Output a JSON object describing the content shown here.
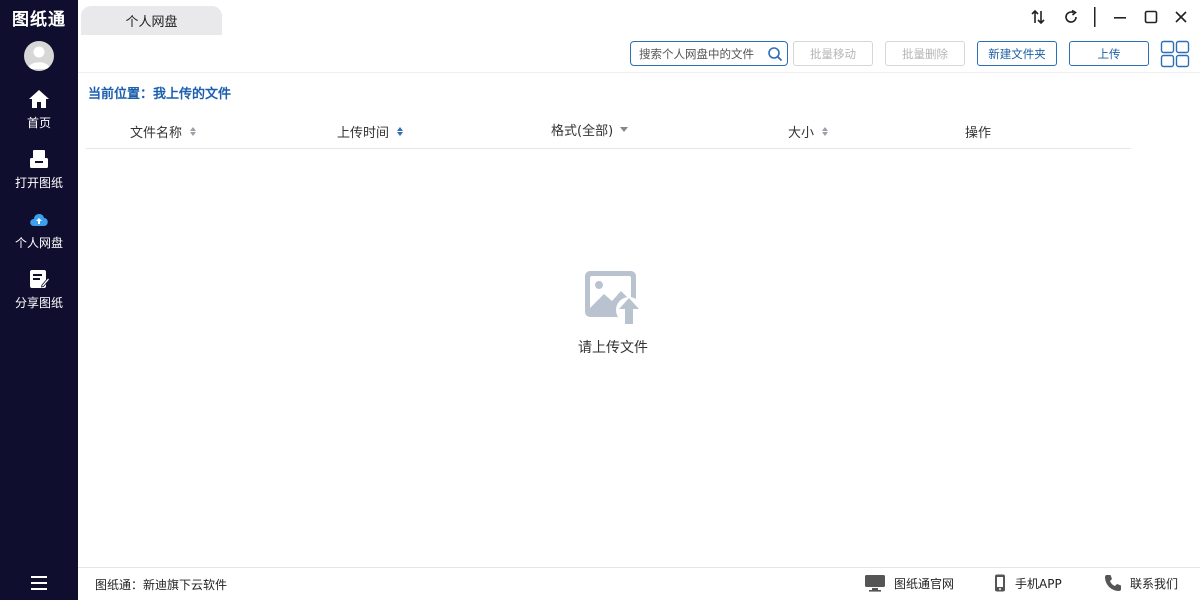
{
  "app": {
    "logo_text": "图纸通"
  },
  "sidebar": {
    "items": [
      {
        "label": "首页",
        "icon": "home-icon"
      },
      {
        "label": "打开图纸",
        "icon": "open-drawing-icon"
      },
      {
        "label": "个人网盘",
        "icon": "cloud-drive-icon",
        "active": true
      },
      {
        "label": "分享图纸",
        "icon": "share-drawing-icon"
      }
    ],
    "menu_icon": "hamburger-menu-icon"
  },
  "tabs": [
    {
      "label": "个人网盘",
      "active": true
    }
  ],
  "window_controls": [
    "transfer-icon",
    "refresh-icon",
    "minimize-icon",
    "maximize-icon",
    "close-icon"
  ],
  "toolbar": {
    "search_placeholder": "搜索个人网盘中的文件",
    "batch_move_label": "批量移动",
    "batch_delete_label": "批量删除",
    "new_folder_label": "新建文件夹",
    "upload_label": "上传"
  },
  "breadcrumb": {
    "prefix": "当前位置：",
    "current": "我上传的文件"
  },
  "table": {
    "columns": [
      {
        "label": "文件名称",
        "control": "sort"
      },
      {
        "label": "上传时间",
        "control": "sort",
        "sort_active": true
      },
      {
        "label": "格式(全部)",
        "control": "dropdown"
      },
      {
        "label": "大小",
        "control": "sort"
      },
      {
        "label": "操作",
        "control": "none"
      }
    ],
    "rows": []
  },
  "empty_state": {
    "icon": "image-upload-icon",
    "text": "请上传文件"
  },
  "footer": {
    "brand_text": "图纸通：新迪旗下云软件",
    "links": [
      {
        "label": "图纸通官网",
        "icon": "monitor-icon"
      },
      {
        "label": "手机APP",
        "icon": "phone-icon"
      },
      {
        "label": "联系我们",
        "icon": "telephone-icon"
      }
    ]
  },
  "colors": {
    "sidebar_bg": "#0f0e2e",
    "accent": "#2d6fb5",
    "breadcrumb": "#1b5fae",
    "disabled_text": "#b5b5b5",
    "empty_icon": "#b9c3cf"
  }
}
